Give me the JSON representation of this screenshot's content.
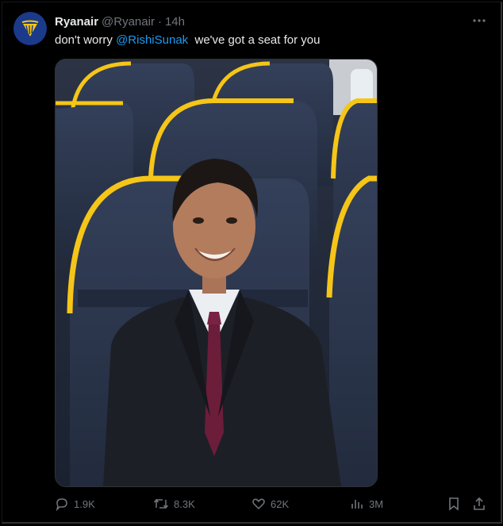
{
  "tweet": {
    "display_name": "Ryanair",
    "handle": "@Ryanair",
    "separator": "·",
    "time": "14h",
    "text_before": "don't worry ",
    "mention": "@RishiSunak",
    "text_after": "  we've got a seat for you"
  },
  "icons": {
    "avatar": "ryanair-harp-logo",
    "more": "more-dots-icon",
    "reply": "reply-icon",
    "retweet": "retweet-icon",
    "like": "heart-icon",
    "views": "views-chart-icon",
    "bookmark": "bookmark-icon",
    "share": "share-icon"
  },
  "media": {
    "subject": "man in dark suit seated in blue airline seats with yellow trim"
  },
  "stats": {
    "replies": "1.9K",
    "retweets": "8.3K",
    "likes": "62K",
    "views": "3M"
  },
  "colors": {
    "background": "#000000",
    "text": "#e7e9ea",
    "muted": "#71767b",
    "link": "#1d9bf0",
    "seat_blue": "#2a3650",
    "seat_yellow": "#f5c518",
    "avatar_blue": "#1b3a8a"
  }
}
